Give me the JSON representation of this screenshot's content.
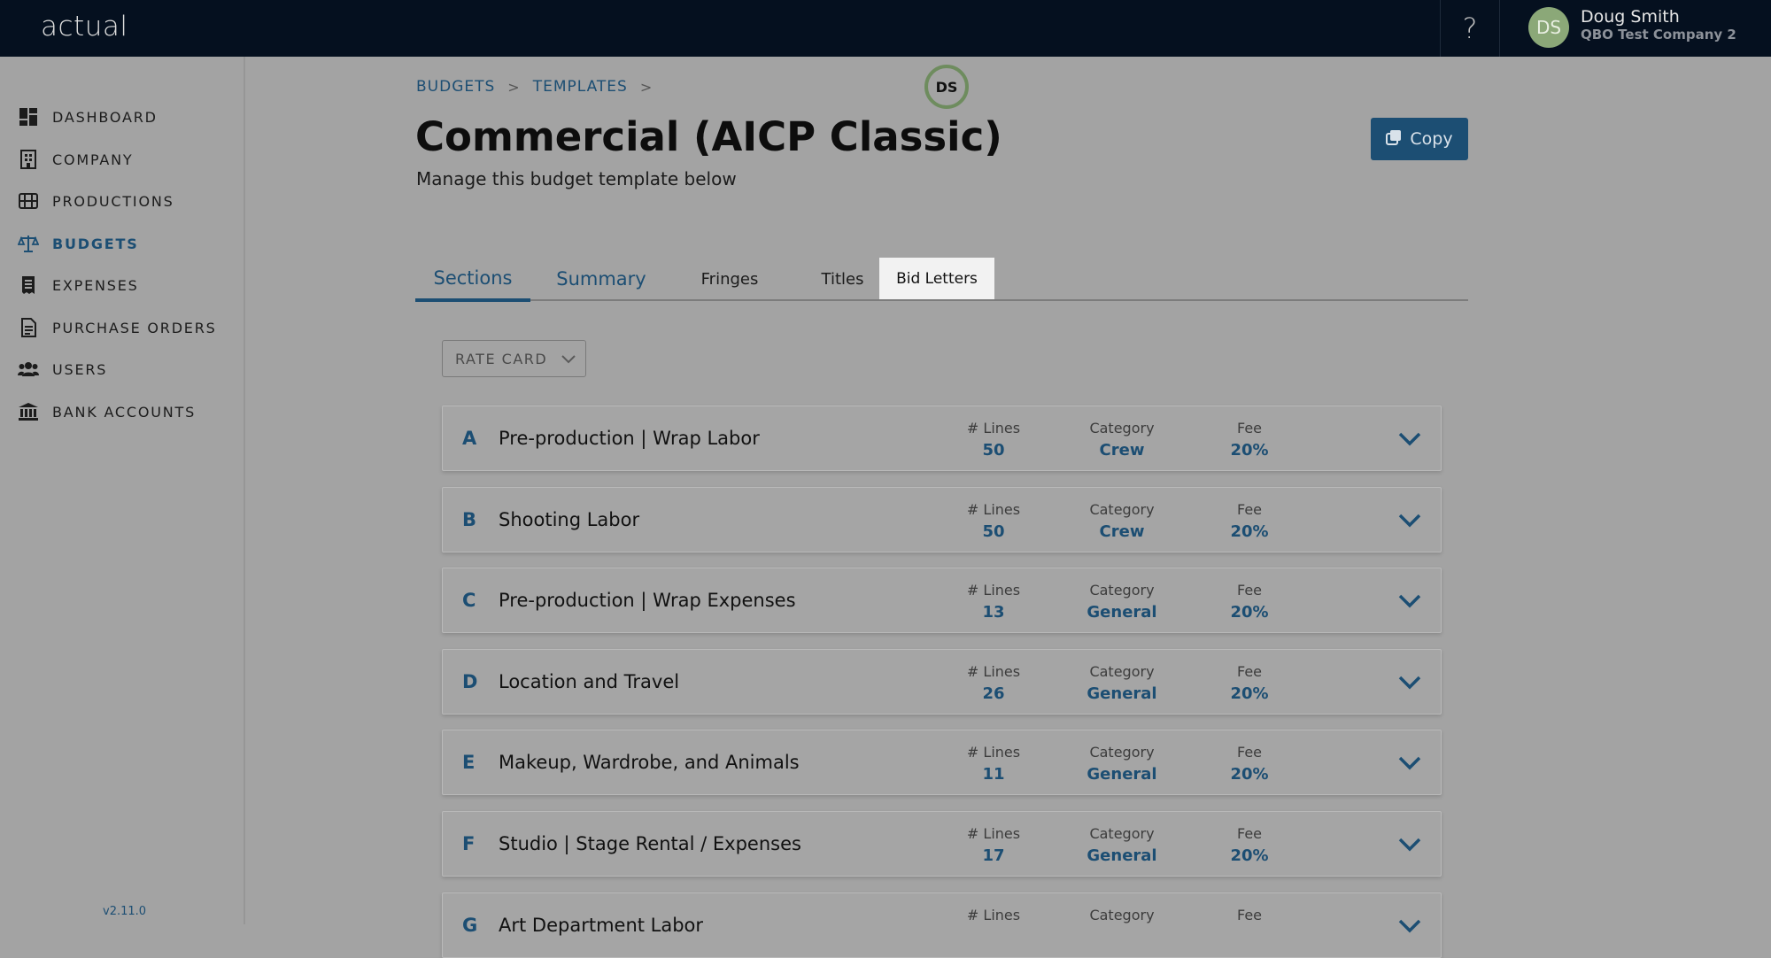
{
  "app": {
    "logo": "actual"
  },
  "header": {
    "help_label": "?",
    "user": {
      "initials": "DS",
      "name": "Doug Smith",
      "company": "QBO Test Company 2"
    }
  },
  "sidebar": {
    "items": [
      {
        "label": "DASHBOARD",
        "icon": "dashboard-icon"
      },
      {
        "label": "COMPANY",
        "icon": "building-icon"
      },
      {
        "label": "PRODUCTIONS",
        "icon": "film-icon"
      },
      {
        "label": "BUDGETS",
        "icon": "scale-icon",
        "active": true
      },
      {
        "label": "EXPENSES",
        "icon": "receipt-icon"
      },
      {
        "label": "PURCHASE ORDERS",
        "icon": "document-icon"
      },
      {
        "label": "USERS",
        "icon": "users-icon"
      },
      {
        "label": "BANK ACCOUNTS",
        "icon": "bank-icon"
      }
    ],
    "version": "v2.11.0"
  },
  "breadcrumb": {
    "items": [
      "BUDGETS",
      "TEMPLATES"
    ]
  },
  "marker": {
    "initials": "DS"
  },
  "page": {
    "title": "Commercial (AICP Classic)",
    "subtitle": "Manage this budget template below",
    "copy_label": "Copy"
  },
  "tabs": [
    "Sections",
    "Summary",
    "Fringes",
    "Titles",
    "Bid Letters"
  ],
  "rate_card": {
    "label": "RATE CARD"
  },
  "labels": {
    "lines": "# Lines",
    "category": "Category",
    "fee": "Fee"
  },
  "sections": [
    {
      "letter": "A",
      "name": "Pre-production | Wrap Labor",
      "lines": "50",
      "category": "Crew",
      "fee": "20%"
    },
    {
      "letter": "B",
      "name": "Shooting Labor",
      "lines": "50",
      "category": "Crew",
      "fee": "20%"
    },
    {
      "letter": "C",
      "name": "Pre-production | Wrap Expenses",
      "lines": "13",
      "category": "General",
      "fee": "20%"
    },
    {
      "letter": "D",
      "name": "Location and Travel",
      "lines": "26",
      "category": "General",
      "fee": "20%"
    },
    {
      "letter": "E",
      "name": "Makeup, Wardrobe, and Animals",
      "lines": "11",
      "category": "General",
      "fee": "20%"
    },
    {
      "letter": "F",
      "name": "Studio | Stage Rental / Expenses",
      "lines": "17",
      "category": "General",
      "fee": "20%"
    },
    {
      "letter": "G",
      "name": "Art Department Labor",
      "lines": "",
      "category": "",
      "fee": ""
    }
  ],
  "colors": {
    "accent": "#1c4e73",
    "topbar": "#05101f",
    "avatar": "#8ba878"
  }
}
